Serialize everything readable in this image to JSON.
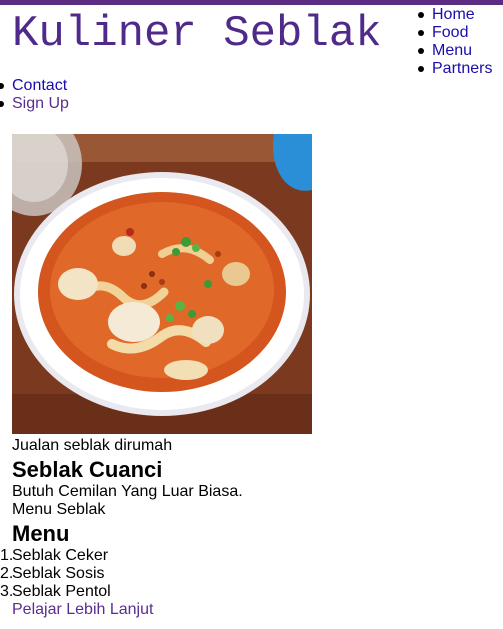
{
  "header": {
    "logo_text": "Kuliner Seblak",
    "accent_color": "#5b2c82"
  },
  "nav_right": [
    {
      "label": "Home"
    },
    {
      "label": "Food"
    },
    {
      "label": "Menu"
    },
    {
      "label": "Partners"
    }
  ],
  "nav_left": [
    {
      "label": "Contact"
    },
    {
      "label": "Sign Up"
    }
  ],
  "hero": {
    "image_subject": "bowl of seblak soup"
  },
  "content": {
    "caption": "Jualan seblak dirumah",
    "title": "Seblak Cuanci",
    "tagline": "Butuh Cemilan Yang Luar Biasa.",
    "menu_subtitle": "Menu Seblak",
    "menu_heading": "Menu",
    "menu_items": [
      {
        "number": "1.",
        "label": "Seblak Ceker"
      },
      {
        "number": "2.",
        "label": "Seblak Sosis"
      },
      {
        "number": "3.",
        "label": "Seblak Pentol"
      }
    ],
    "more_link": "Pelajar Lebih Lanjut"
  }
}
